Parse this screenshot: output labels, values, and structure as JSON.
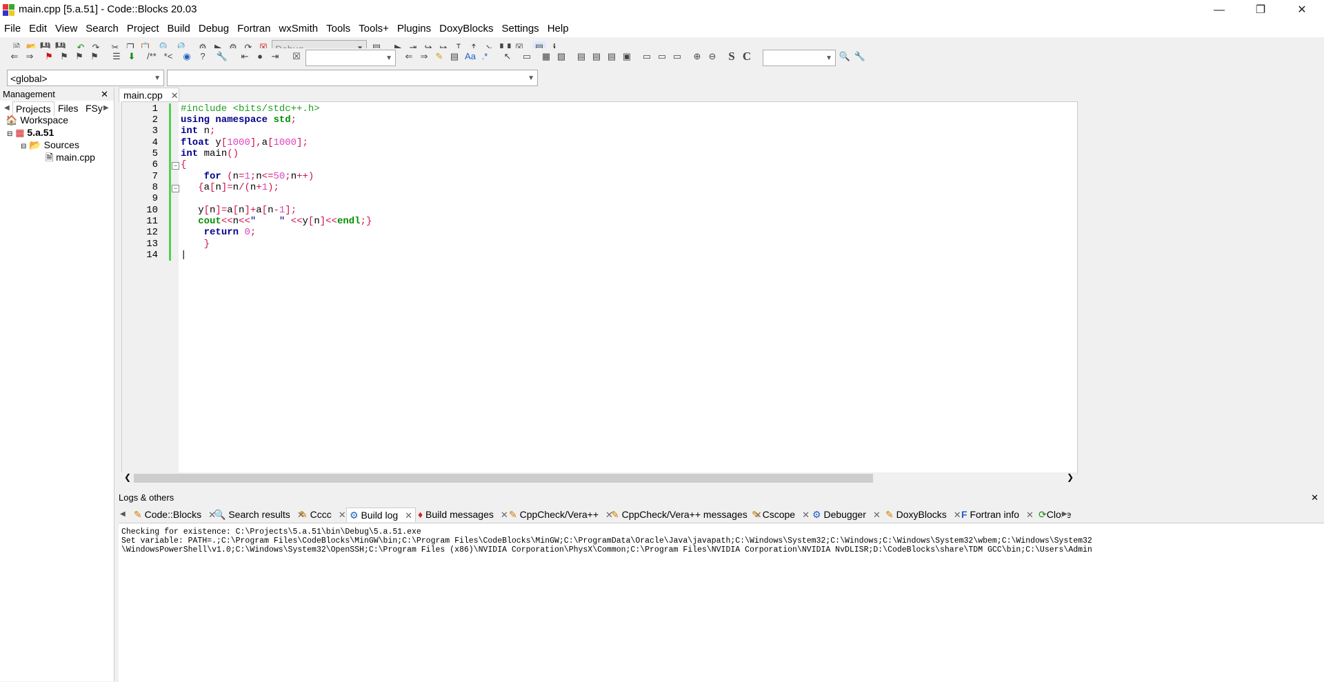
{
  "window": {
    "title": "main.cpp [5.a.51] - Code::Blocks 20.03"
  },
  "menu": [
    "File",
    "Edit",
    "View",
    "Search",
    "Project",
    "Build",
    "Debug",
    "Fortran",
    "wxSmith",
    "Tools",
    "Tools+",
    "Plugins",
    "DoxyBlocks",
    "Settings",
    "Help"
  ],
  "toolbar": {
    "build_target": "Debug",
    "scope": "<global>",
    "symbol": "",
    "search": "",
    "find_field": ""
  },
  "management": {
    "title": "Management",
    "tabs": [
      "Projects",
      "Files",
      "FSy"
    ],
    "tree": {
      "workspace": "Workspace",
      "project": "5.a.51",
      "folder": "Sources",
      "file": "main.cpp"
    }
  },
  "editor": {
    "tab": "main.cpp",
    "lines": [
      "1",
      "2",
      "3",
      "4",
      "5",
      "6",
      "7",
      "8",
      "9",
      "10",
      "11",
      "12",
      "13",
      "14"
    ]
  },
  "logs": {
    "title": "Logs & others",
    "tabs": [
      "Code::Blocks",
      "Search results",
      "Cccc",
      "Build log",
      "Build messages",
      "CppCheck/Vera++",
      "CppCheck/Vera++ messages",
      "Cscope",
      "Debugger",
      "DoxyBlocks",
      "Fortran info",
      "Close"
    ],
    "lines": [
      "Checking for existence: C:\\Projects\\5.a.51\\bin\\Debug\\5.a.51.exe",
      "Set variable: PATH=.;C:\\Program Files\\CodeBlocks\\MinGW\\bin;C:\\Program Files\\CodeBlocks\\MinGW;C:\\ProgramData\\Oracle\\Java\\javapath;C:\\Windows\\System32;C:\\Windows;C:\\Windows\\System32\\wbem;C:\\Windows\\System32",
      "\\WindowsPowerShell\\v1.0;C:\\Windows\\System32\\OpenSSH;C:\\Program Files (x86)\\NVIDIA Corporation\\PhysX\\Common;C:\\Program Files\\NVIDIA Corporation\\NVIDIA NvDLISR;D:\\CodeBlocks\\share\\TDM GCC\\bin;C:\\Users\\Admin"
    ]
  },
  "colors": {
    "keyword": "#00008b",
    "preprocessor": "#1e9e1e",
    "number": "#e040c0",
    "operator": "#d0104c",
    "changebar": "#4dd24d"
  }
}
